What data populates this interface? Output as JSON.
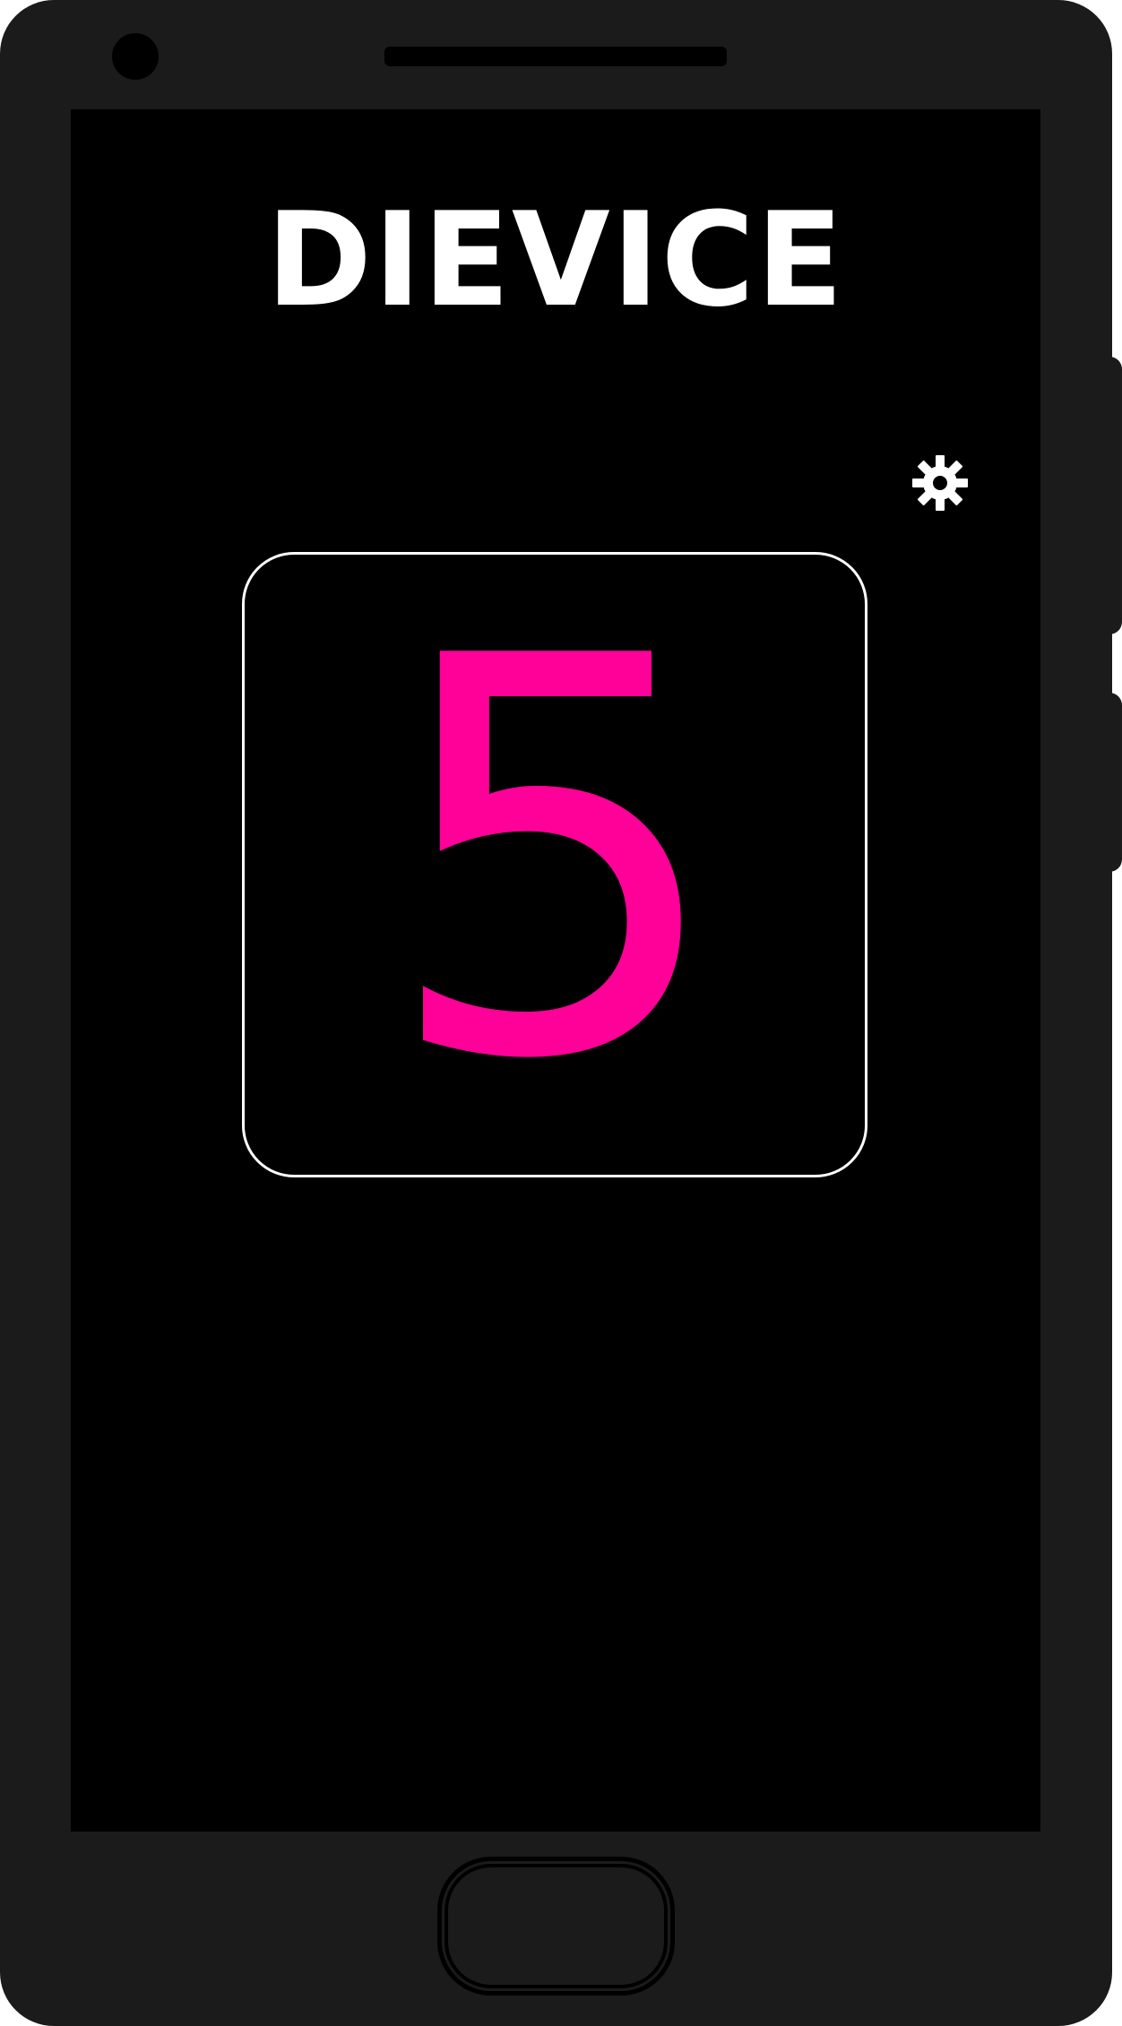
{
  "app": {
    "title": "DIEVICE"
  },
  "counter": {
    "value": "5",
    "color": "#ff0099"
  },
  "icons": {
    "settings": "gear-icon"
  },
  "colors": {
    "device_body": "#1b1b1b",
    "screen": "#000000",
    "text": "#ffffff",
    "accent": "#ff0099"
  }
}
